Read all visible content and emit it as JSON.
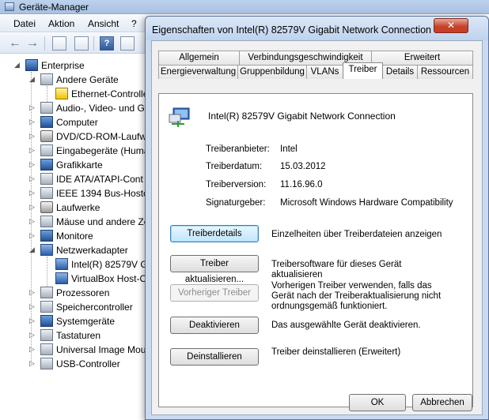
{
  "device_manager": {
    "title": "Geräte-Manager",
    "menu": [
      "Datei",
      "Aktion",
      "Ansicht",
      "?"
    ],
    "tree": {
      "root": "Enterprise",
      "items": [
        {
          "label": "Andere Geräte",
          "icon": "unknown-device-icon"
        },
        {
          "label": "Ethernet-Controlle",
          "icon": "warning-device-icon"
        },
        {
          "label": "Audio-, Video- und G",
          "icon": "audio-icon"
        },
        {
          "label": "Computer",
          "icon": "computer-icon"
        },
        {
          "label": "DVD/CD-ROM-Laufw",
          "icon": "dvd-drive-icon"
        },
        {
          "label": "Eingabegeräte (Huma",
          "icon": "input-device-icon"
        },
        {
          "label": "Grafikkarte",
          "icon": "display-adapter-icon"
        },
        {
          "label": "IDE ATA/ATAPI-Cont",
          "icon": "ide-controller-icon"
        },
        {
          "label": "IEEE 1394 Bus-Hostco",
          "icon": "ieee1394-icon"
        },
        {
          "label": "Laufwerke",
          "icon": "disk-drive-icon"
        },
        {
          "label": "Mäuse und andere Ze",
          "icon": "mouse-icon"
        },
        {
          "label": "Monitore",
          "icon": "monitor-icon"
        },
        {
          "label": "Netzwerkadapter",
          "icon": "network-adapter-icon"
        },
        {
          "label": "Intel(R) 82579V Gig",
          "icon": "network-adapter-icon"
        },
        {
          "label": "VirtualBox Host-O",
          "icon": "network-adapter-icon"
        },
        {
          "label": "Prozessoren",
          "icon": "processor-icon"
        },
        {
          "label": "Speichercontroller",
          "icon": "storage-controller-icon"
        },
        {
          "label": "Systemgeräte",
          "icon": "system-device-icon"
        },
        {
          "label": "Tastaturen",
          "icon": "keyboard-icon"
        },
        {
          "label": "Universal Image Mou",
          "icon": "image-mount-icon"
        },
        {
          "label": "USB-Controller",
          "icon": "usb-icon"
        }
      ]
    }
  },
  "dialog": {
    "title": "Eigenschaften von Intel(R) 82579V Gigabit Network Connection",
    "close_label": "✕",
    "tabs_row1": [
      "Allgemein",
      "Verbindungsgeschwindigkeit",
      "Erweitert"
    ],
    "tabs_row2": [
      "Energieverwaltung",
      "Gruppenbildung",
      "VLANs",
      "Treiber",
      "Details",
      "Ressourcen"
    ],
    "active_tab": "Treiber",
    "device_name": "Intel(R) 82579V Gigabit Network Connection",
    "props": [
      {
        "key": "Treiberanbieter:",
        "value": "Intel"
      },
      {
        "key": "Treiberdatum:",
        "value": "15.03.2012"
      },
      {
        "key": "Treiberversion:",
        "value": "11.16.96.0"
      },
      {
        "key": "Signaturgeber:",
        "value": "Microsoft Windows Hardware Compatibility"
      }
    ],
    "actions": [
      {
        "label": "Treiberdetails",
        "desc": "Einzelheiten über Treiberdateien anzeigen"
      },
      {
        "label": "Treiber aktualisieren...",
        "desc": "Treibersoftware für dieses Gerät aktualisieren"
      },
      {
        "label": "Vorheriger Treiber",
        "desc": "Vorherigen Treiber verwenden, falls das Gerät nach der Treiberaktualisierung nicht ordnungsgemäß funktioniert."
      },
      {
        "label": "Deaktivieren",
        "desc": "Das ausgewählte Gerät deaktivieren."
      },
      {
        "label": "Deinstallieren",
        "desc": "Treiber deinstallieren (Erweitert)"
      }
    ],
    "ok_label": "OK",
    "cancel_label": "Abbrechen"
  }
}
